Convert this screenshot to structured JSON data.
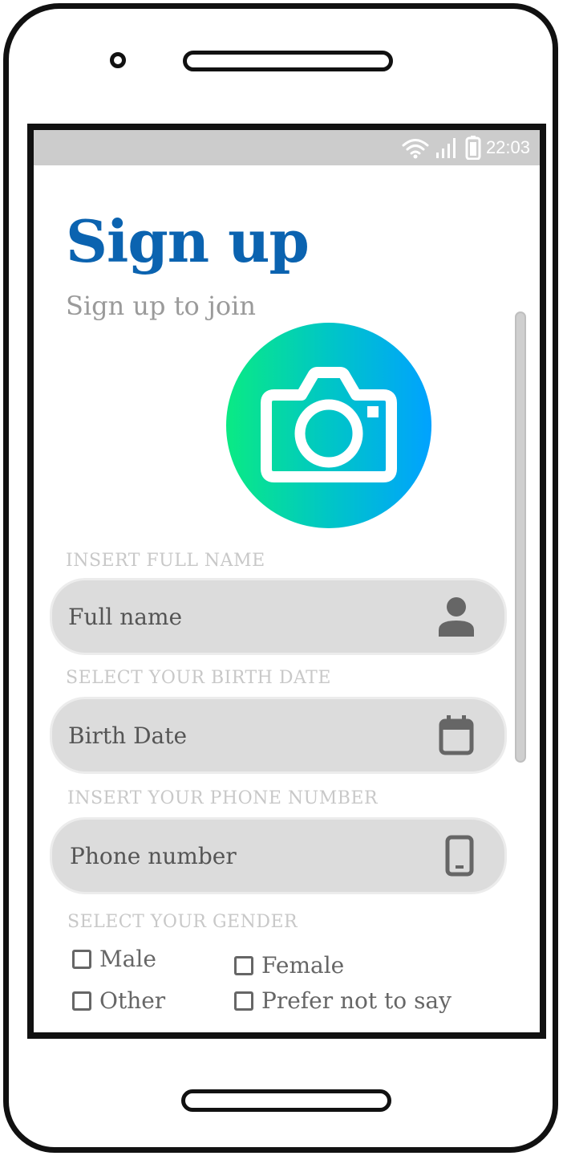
{
  "status_bar": {
    "time": "22:03",
    "icons": [
      "wifi-icon",
      "signal-icon",
      "battery-icon"
    ]
  },
  "header": {
    "title": "Sign up",
    "subtitle": "Sign up to join"
  },
  "photo": {
    "icon": "camera-icon"
  },
  "form": {
    "full_name": {
      "label": "INSERT FULL NAME",
      "placeholder": "Full name",
      "icon": "person-icon"
    },
    "birth_date": {
      "label": "SELECT YOUR BIRTH DATE",
      "placeholder": "Birth Date",
      "icon": "calendar-icon"
    },
    "phone": {
      "label": "INSERT YOUR PHONE NUMBER",
      "placeholder": "Phone number",
      "icon": "smartphone-icon"
    },
    "gender": {
      "label": "SELECT YOUR GENDER",
      "options": [
        "Male",
        "Female",
        "Other",
        "Prefer not to say"
      ]
    }
  },
  "colors": {
    "accent": "#0b63b0",
    "gradient_start": "#0aea84",
    "gradient_end": "#00a2ff",
    "field_bg": "#dcdcdc"
  }
}
